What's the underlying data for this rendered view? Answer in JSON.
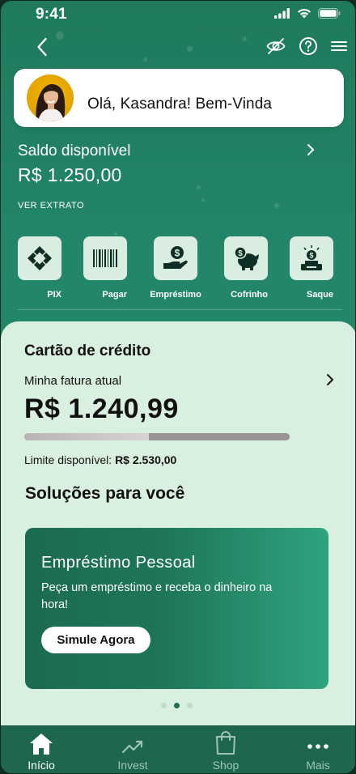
{
  "status_bar": {
    "time": "9:41"
  },
  "greeting": {
    "text": "Olá,  Kasandra! Bem-Vinda"
  },
  "balance": {
    "label": "Saldo disponível",
    "value": "R$ 1.250,00",
    "statement_link": "VER EXTRATO"
  },
  "quick_actions": [
    {
      "label": "PIX",
      "icon": "pix-icon"
    },
    {
      "label": "Pagar",
      "icon": "barcode-icon"
    },
    {
      "label": "Empréstimo",
      "icon": "money-hand-icon"
    },
    {
      "label": "Cofrinho",
      "icon": "piggy-bank-icon"
    },
    {
      "label": "Saque",
      "icon": "cash-withdraw-icon"
    }
  ],
  "credit_card": {
    "title": "Cartão de crédito",
    "invoice_label": "Minha fatura atual",
    "invoice_value": "R$ 1.240,99",
    "limit_label": "Limite disponível: ",
    "limit_value": "R$ 2.530,00",
    "limit_used_fraction": 0.47
  },
  "solutions": {
    "title": "Soluções para você",
    "promo": {
      "title": "Empréstimo Pessoal",
      "description": "Peça um empréstimo e receba o dinheiro na hora!",
      "button": "Simule Agora"
    },
    "pager": {
      "count": 3,
      "active": 1
    }
  },
  "bottom_nav": [
    {
      "label": "Início",
      "icon": "home-icon",
      "active": true
    },
    {
      "label": "Invest",
      "icon": "trending-up-icon",
      "active": false
    },
    {
      "label": "Shop",
      "icon": "shopping-bag-icon",
      "active": false
    },
    {
      "label": "Mais",
      "icon": "more-dots-icon",
      "active": false
    }
  ],
  "colors": {
    "brand_green": "#23866a",
    "sheet_bg": "#d9efdf",
    "tile_bg": "#d9ede0",
    "icon_dark": "#0f2f26",
    "nav_bg": "#1e6650"
  }
}
